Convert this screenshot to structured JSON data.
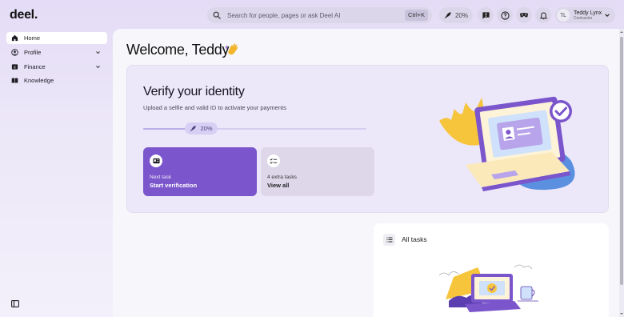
{
  "app": {
    "logo": "deel."
  },
  "search": {
    "placeholder": "Search for people, pages or ask Deel AI",
    "shortcut": "Ctrl+K"
  },
  "header": {
    "progress_label": "20%",
    "icons": [
      "rocket-icon",
      "feedback-icon",
      "help-icon",
      "mask-icon",
      "bell-icon"
    ],
    "user": {
      "initials": "TL",
      "name": "Teddy Lynx",
      "role": "Contractor"
    }
  },
  "sidebar": {
    "items": [
      {
        "label": "Home",
        "icon": "home-icon",
        "active": true
      },
      {
        "label": "Profile",
        "icon": "profile-icon",
        "expandable": true
      },
      {
        "label": "Finance",
        "icon": "finance-icon",
        "expandable": true
      },
      {
        "label": "Knowledge",
        "icon": "book-icon"
      }
    ]
  },
  "main": {
    "welcome": "Welcome, Teddy"
  },
  "verify": {
    "title": "Verify your identity",
    "subtitle": "Upload a selfie and valid ID to activate your payments",
    "progress": 0.2,
    "progress_label": "20%",
    "next_task": {
      "kicker": "Next task",
      "label": "Start verification"
    },
    "extra_tasks": {
      "kicker": "4 extra tasks",
      "label": "View all"
    }
  },
  "tasks": {
    "title": "All tasks"
  },
  "colors": {
    "accent": "#7a55cc",
    "accent_light": "#ece7f9"
  }
}
